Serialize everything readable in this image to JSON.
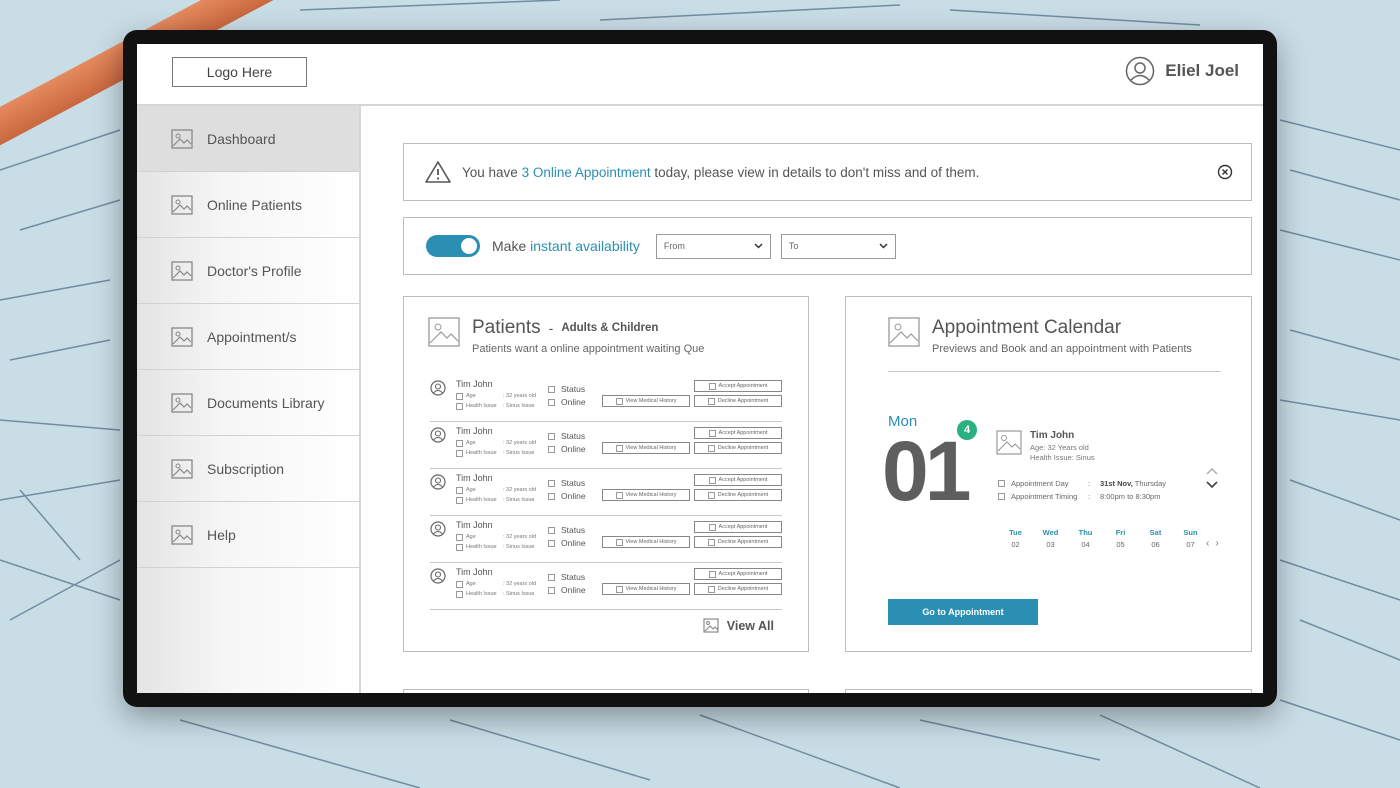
{
  "header": {
    "logo_label": "Logo Here",
    "user_name": "Eliel Joel"
  },
  "sidebar": {
    "items": [
      {
        "label": "Dashboard",
        "active": true
      },
      {
        "label": "Online Patients"
      },
      {
        "label": "Doctor's Profile"
      },
      {
        "label": "Appointment/s"
      },
      {
        "label": "Documents Library"
      },
      {
        "label": "Subscription"
      },
      {
        "label": "Help"
      }
    ]
  },
  "alert": {
    "prefix": "You have ",
    "link": "3 Online Appointment",
    "suffix": " today, please view in details to don't miss and of them."
  },
  "availability": {
    "label_prefix": "Make ",
    "label_link": "instant availability",
    "toggle_on": true,
    "from_label": "From",
    "to_label": "To"
  },
  "patients": {
    "title": "Patients",
    "separator": "-",
    "tag": "Adults & Children",
    "subtitle": "Patients want a online appointment waiting Que",
    "rows": [
      {
        "name": "Tim John",
        "age_label": "Age",
        "age_value": ": 32 years old",
        "issue_label": "Health Issue",
        "issue_value": ": Sinus Issue",
        "status_label": "Status",
        "status_value": "Online"
      },
      {
        "name": "Tim John",
        "age_label": "Age",
        "age_value": ": 32 years old",
        "issue_label": "Health Issue",
        "issue_value": ": Sinus Issue",
        "status_label": "Status",
        "status_value": "Online"
      },
      {
        "name": "Tim John",
        "age_label": "Age",
        "age_value": ": 32 years old",
        "issue_label": "Health Issue",
        "issue_value": ": Sinus Issue",
        "status_label": "Status",
        "status_value": "Online"
      },
      {
        "name": "Tim John",
        "age_label": "Age",
        "age_value": ": 32 years old",
        "issue_label": "Health Issue",
        "issue_value": ": Sinus Issue",
        "status_label": "Status",
        "status_value": "Online"
      },
      {
        "name": "Tim John",
        "age_label": "Age",
        "age_value": ": 32 years old",
        "issue_label": "Health Issue",
        "issue_value": ": Sinus Issue",
        "status_label": "Status",
        "status_value": "Online"
      }
    ],
    "accept_label": "Accept Appointment",
    "decline_label": "Decline Appointment",
    "history_label": "View Medical History",
    "view_all_label": "View All"
  },
  "calendar": {
    "title": "Appointment Calendar",
    "subtitle": "Previews and Book and an appointment with Patients",
    "day_name": "Mon",
    "date": "01",
    "badge_count": "4",
    "patient_name": "Tim John",
    "patient_age": "Age: 32 Years old",
    "patient_issue": "Health Issue: Sinus",
    "appt_day_label": "Appointment Day",
    "appt_day_value_bold": "31st Nov,",
    "appt_day_value_rest": " Thursday",
    "appt_time_label": "Appointment Timing",
    "appt_time_value": "8:00pm to 8:30pm",
    "colon": ":",
    "week": [
      {
        "day": "Tue",
        "num": "02"
      },
      {
        "day": "Wed",
        "num": "03"
      },
      {
        "day": "Thu",
        "num": "04"
      },
      {
        "day": "Fri",
        "num": "05"
      },
      {
        "day": "Sat",
        "num": "06"
      },
      {
        "day": "Sun",
        "num": "07"
      }
    ],
    "prev_glyph": "‹",
    "next_glyph": "›",
    "go_button_label": "Go to Appointment"
  },
  "colors": {
    "accent": "#2a8fb3",
    "badge": "#2bb07f"
  }
}
